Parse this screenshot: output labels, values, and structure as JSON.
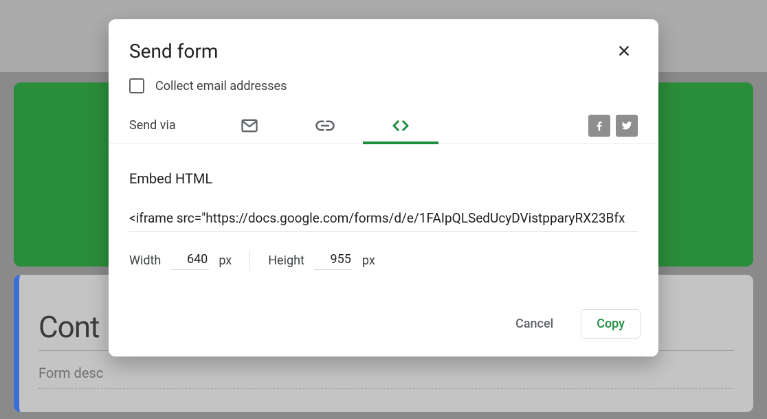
{
  "background": {
    "card_title": "Cont",
    "card_desc": "Form desc"
  },
  "dialog": {
    "title": "Send form",
    "collect_label": "Collect email addresses",
    "collect_checked": false,
    "sendvia_label": "Send via",
    "tabs": {
      "email": "email",
      "link": "link",
      "embed": "embed",
      "active": "embed"
    },
    "section_title": "Embed HTML",
    "embed_value": "<iframe src=\"https://docs.google.com/forms/d/e/1FAIpQLSedUcyDVistpparyRX23Bfx",
    "width": {
      "label": "Width",
      "value": "640",
      "unit": "px"
    },
    "height": {
      "label": "Height",
      "value": "955",
      "unit": "px"
    },
    "cancel_label": "Cancel",
    "copy_label": "Copy"
  },
  "colors": {
    "accent": "#1e8e3e"
  }
}
